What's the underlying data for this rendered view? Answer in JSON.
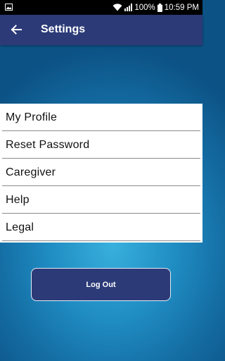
{
  "status_bar": {
    "battery_text": "100%",
    "time": "10:59 PM"
  },
  "app_bar": {
    "title": "Settings"
  },
  "menu": {
    "items": [
      {
        "label": "My Profile"
      },
      {
        "label": "Reset Password"
      },
      {
        "label": "Caregiver"
      },
      {
        "label": "Help"
      },
      {
        "label": "Legal"
      }
    ]
  },
  "logout": {
    "label": "Log Out"
  },
  "colors": {
    "app_bar": "#2c3b78",
    "button": "#2c3b78",
    "background_light": "#38b0dc",
    "background_dark": "#0c5285"
  },
  "icons": {
    "status_left": "gallery-icon",
    "wifi": "wifi-icon",
    "signal": "signal-icon",
    "battery": "battery-icon",
    "back": "arrow-left-icon"
  }
}
